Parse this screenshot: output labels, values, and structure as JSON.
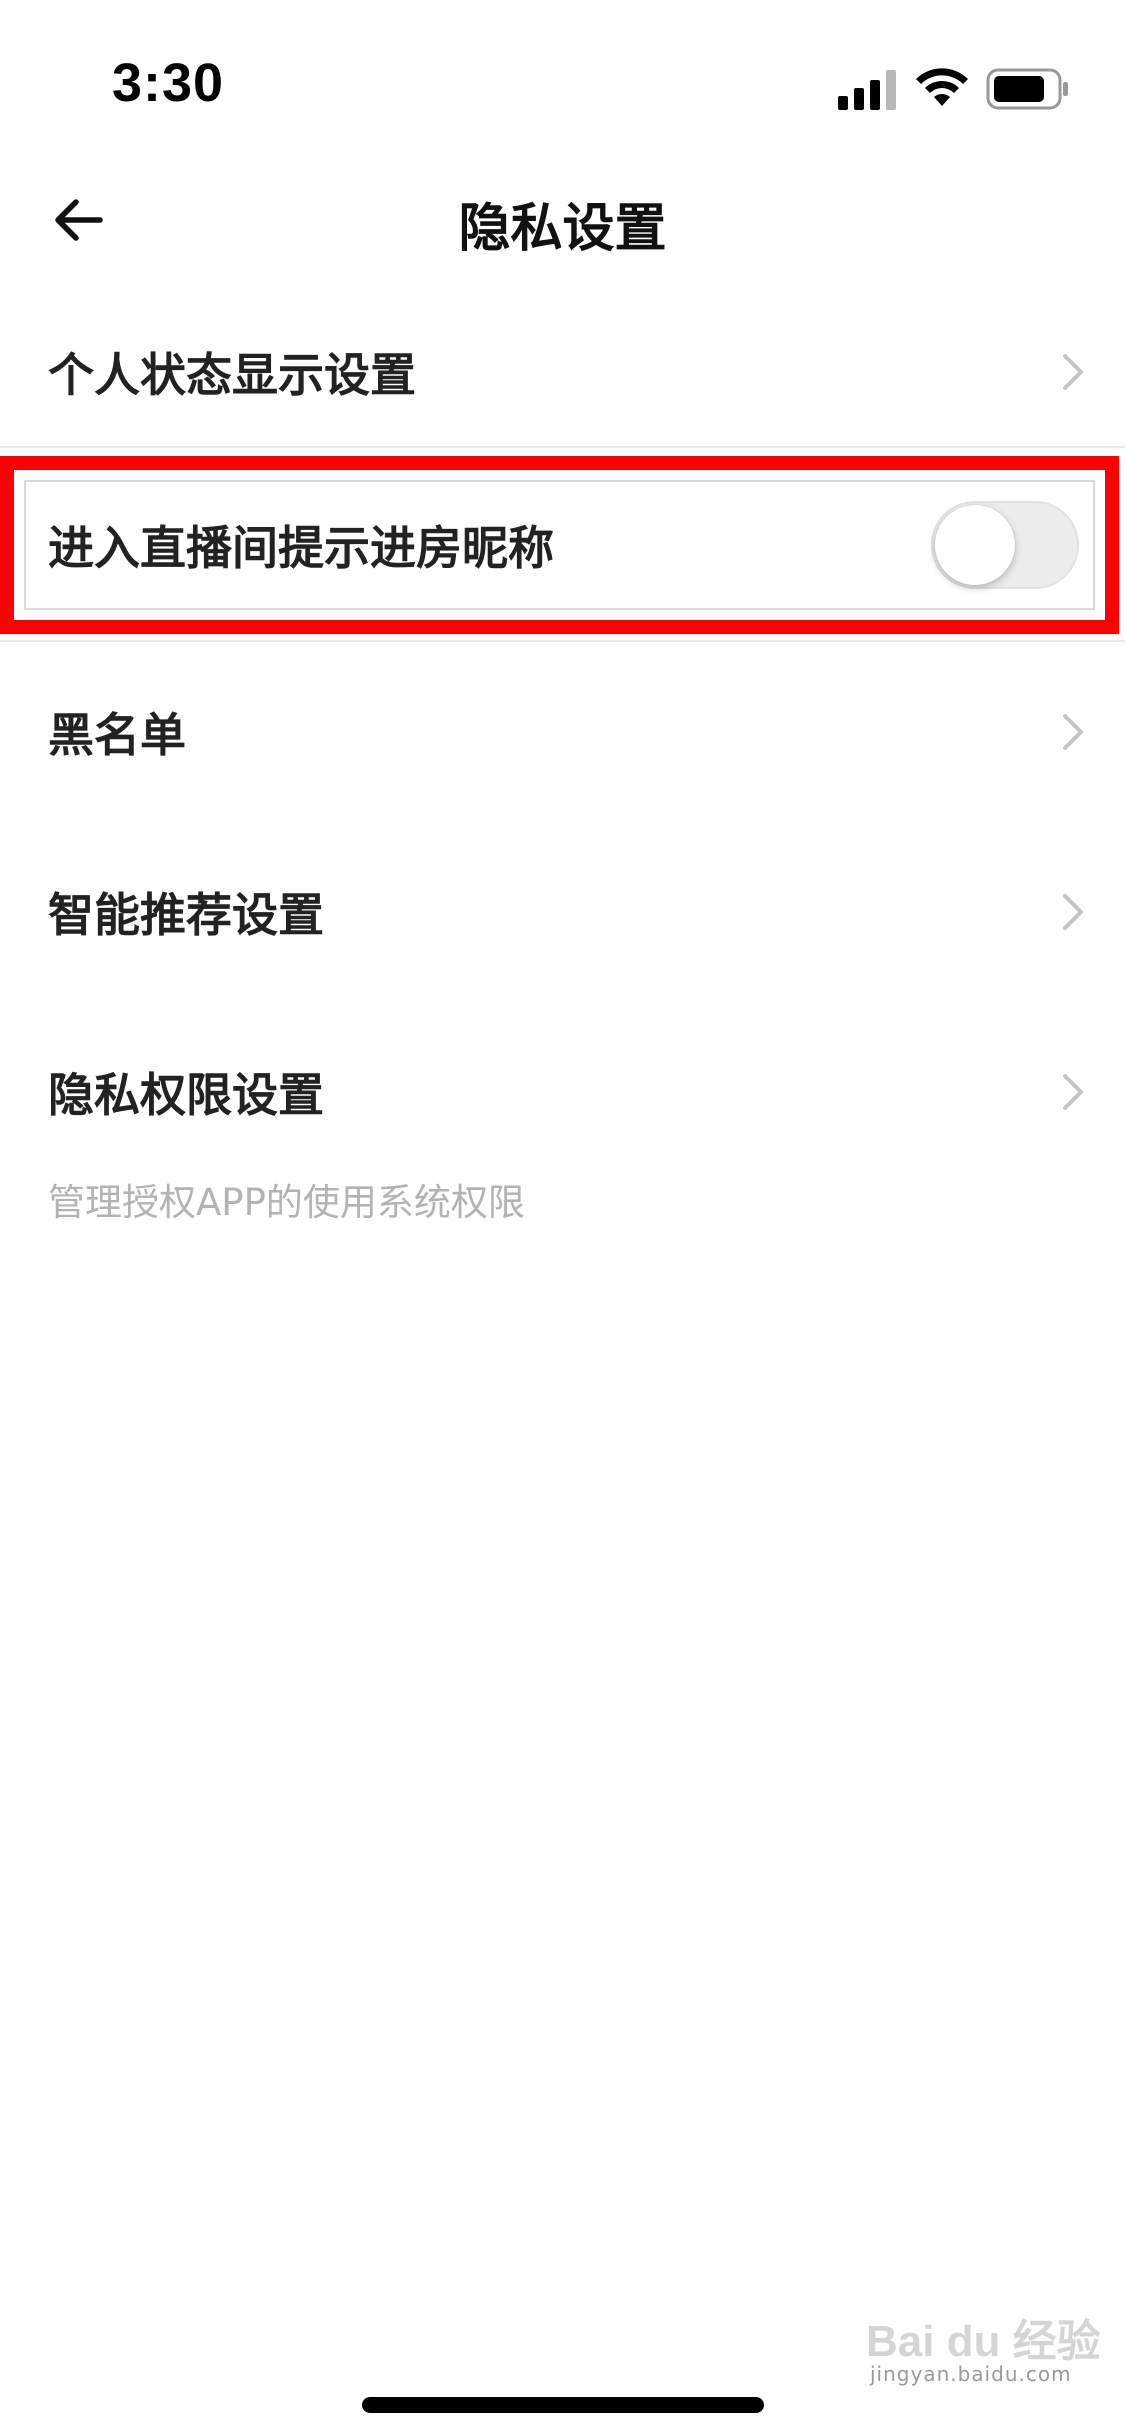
{
  "status_bar": {
    "time": "3:30"
  },
  "nav": {
    "title": "隐私设置",
    "back_icon": "arrow-left-icon"
  },
  "list": {
    "items": [
      {
        "label": "个人状态显示设置",
        "control": "chevron"
      },
      {
        "label": "进入直播间提示进房昵称",
        "control": "toggle",
        "toggle_on": false,
        "highlighted": true
      },
      {
        "label": "黑名单",
        "control": "chevron"
      },
      {
        "label": "智能推荐设置",
        "control": "chevron"
      },
      {
        "label": "隐私权限设置",
        "control": "chevron"
      }
    ],
    "privacy_subtext": "管理授权APP的使用系统权限"
  },
  "colors": {
    "highlight": "#ff0000",
    "text_primary": "#222222",
    "text_secondary": "#b3b3b3",
    "toggle_off": "#ececec"
  },
  "watermark": {
    "logo": "Bai du 经验",
    "url": "jingyan.baidu.com"
  }
}
